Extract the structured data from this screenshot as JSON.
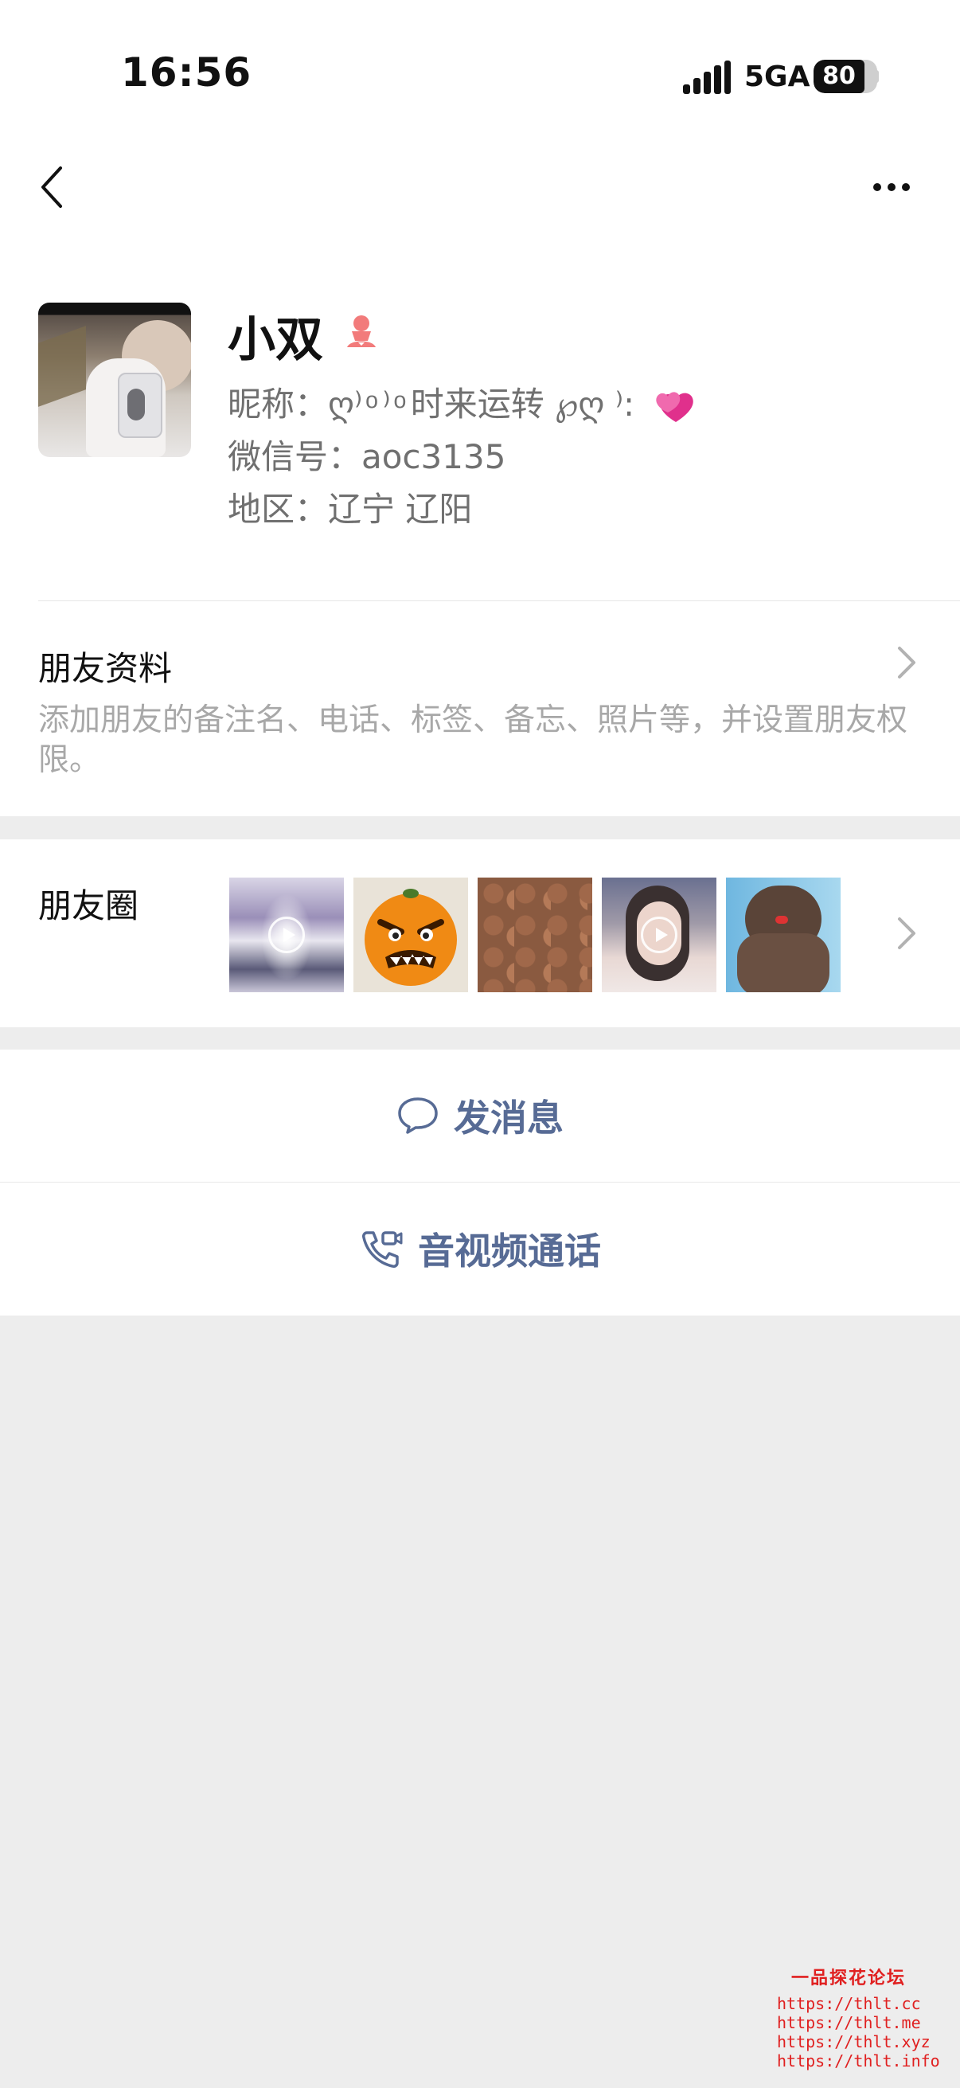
{
  "status_bar": {
    "time": "16:56",
    "network": "5GA",
    "battery": "80",
    "battery_level": 0.8
  },
  "nav": {
    "back_icon": "chevron-left-icon",
    "more_icon": "more-icon"
  },
  "profile": {
    "name": "小双",
    "gender_icon": "female-icon",
    "nickname_line": "昵称：ღ⁾ ͦ  ⁾ ͦ 时来运转 ℘ღ ⁾:",
    "wechat_id_line": "微信号：aoc3135",
    "region_line": "地区：辽宁 辽阳"
  },
  "friend_info": {
    "title": "朋友资料",
    "description": "添加朋友的备注名、电话、标签、备忘、照片等，并设置朋友权限。"
  },
  "moments": {
    "title": "朋友圈"
  },
  "actions": {
    "message": "发消息",
    "call": "音视频通话"
  },
  "watermark": {
    "title": "一品探花论坛",
    "urls": [
      "https://thlt.cc",
      "https://thlt.me",
      "https://thlt.xyz",
      "https://thlt.info"
    ]
  },
  "colors": {
    "link_blue": "#576b95",
    "background": "#ededed",
    "watermark_red": "#e02020",
    "female_pink": "#f27b7b"
  }
}
